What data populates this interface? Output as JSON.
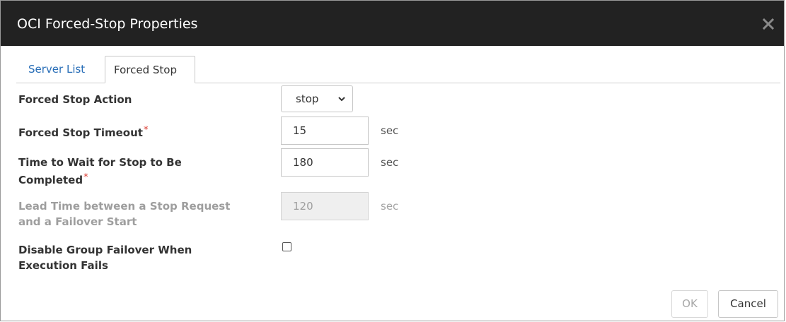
{
  "dialog": {
    "title": "OCI Forced-Stop Properties",
    "close_icon": "close-icon"
  },
  "tabs": [
    {
      "label": "Server List",
      "active": false
    },
    {
      "label": "Forced Stop",
      "active": true
    }
  ],
  "form": {
    "forced_stop_action": {
      "label": "Forced Stop Action",
      "value": "stop",
      "options": [
        "stop"
      ]
    },
    "forced_stop_timeout": {
      "label": "Forced Stop Timeout",
      "required_mark": "*",
      "value": "15",
      "unit": "sec"
    },
    "wait_for_stop": {
      "label_line1": "Time to Wait for Stop to Be",
      "label_line2": "Completed",
      "required_mark": "*",
      "value": "180",
      "unit": "sec"
    },
    "lead_time": {
      "label_line1": "Lead Time between a Stop Request",
      "label_line2": "and a Failover Start",
      "value": "120",
      "unit": "sec",
      "disabled": true
    },
    "disable_group_failover": {
      "label_line1": "Disable Group Failover When",
      "label_line2": "Execution Fails",
      "checked": false
    }
  },
  "buttons": {
    "ok_label": "OK",
    "cancel_label": "Cancel"
  },
  "colors": {
    "titlebar": "#222222",
    "link": "#2a6fb8",
    "required": "#d9362b",
    "disabled_text": "#9e9e9e"
  }
}
